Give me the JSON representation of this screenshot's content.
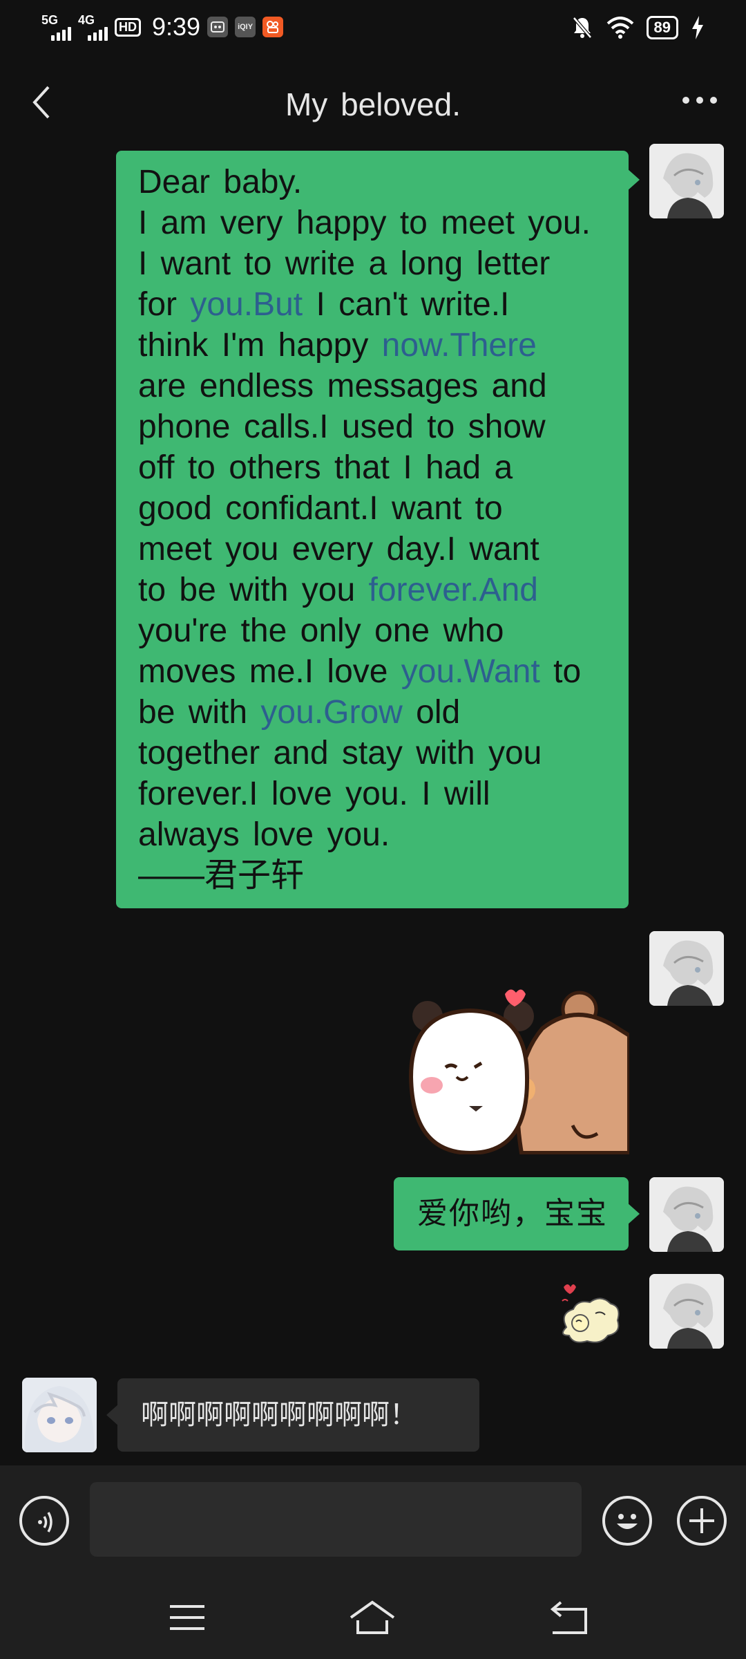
{
  "status_bar": {
    "net1": "5G",
    "net2": "4G",
    "hd": "HD",
    "time": "9:39",
    "app_icon_2": "iQIY",
    "battery": "89"
  },
  "header": {
    "title": "My beloved."
  },
  "messages": {
    "letter_lines": [
      [
        "Dear baby.",
        ""
      ],
      [
        "I am very happy to meet you.",
        ""
      ],
      [
        "I want to write a long letter",
        ""
      ],
      [
        "for ",
        "you.But",
        " I can't write.I"
      ],
      [
        "think I'm happy ",
        "now.There",
        ""
      ],
      [
        "are endless messages and",
        ""
      ],
      [
        "phone calls.I used to show",
        ""
      ],
      [
        "off to others that I had a",
        ""
      ],
      [
        "good confidant.I want to",
        ""
      ],
      [
        "meet you every day.I want",
        ""
      ],
      [
        "to be with you ",
        "forever.And",
        ""
      ],
      [
        "you're the only one who",
        ""
      ],
      [
        "moves me.I love ",
        "you.Want",
        " to"
      ],
      [
        "be with ",
        "you.Grow",
        " old"
      ],
      [
        "together and stay with you",
        ""
      ],
      [
        "forever.I love you. I will",
        ""
      ],
      [
        "always love you.",
        ""
      ],
      [
        "——君子轩",
        ""
      ]
    ],
    "short_reply": "爱你哟，宝宝",
    "incoming": "啊啊啊啊啊啊啊啊啊！"
  },
  "input": {
    "placeholder": ""
  },
  "colors": {
    "background": "#111111",
    "bubble_sent": "#3fb872",
    "bubble_received": "#2c2c2c",
    "link": "#2d5f8f",
    "bar": "#1f1f1f"
  },
  "icons": [
    "back-arrow-icon",
    "more-dots-icon",
    "voice-icon",
    "emoji-icon",
    "plus-icon",
    "menu-icon",
    "home-icon",
    "back-nav-icon"
  ]
}
